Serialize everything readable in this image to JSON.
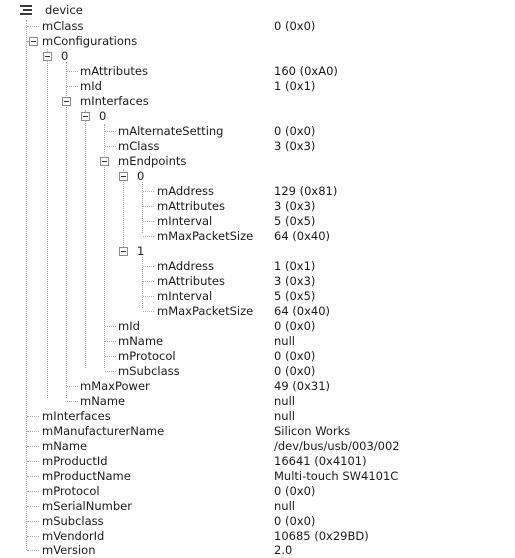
{
  "tree": {
    "root_label": "device",
    "rows": [
      {
        "label": "device",
        "value": "",
        "toggle": false,
        "root": true
      },
      {
        "label": "mClass",
        "value": "0 (0x0)"
      },
      {
        "label": "mConfigurations",
        "value": "",
        "toggle": true
      },
      {
        "label": "0",
        "value": "",
        "toggle": true
      },
      {
        "label": "mAttributes",
        "value": "160 (0xA0)"
      },
      {
        "label": "mId",
        "value": "1 (0x1)"
      },
      {
        "label": "mInterfaces",
        "value": "",
        "toggle": true
      },
      {
        "label": "0",
        "value": "",
        "toggle": true
      },
      {
        "label": "mAlternateSetting",
        "value": "0 (0x0)"
      },
      {
        "label": "mClass",
        "value": "3 (0x3)"
      },
      {
        "label": "mEndpoints",
        "value": "",
        "toggle": true
      },
      {
        "label": "0",
        "value": "",
        "toggle": true
      },
      {
        "label": "mAddress",
        "value": "129 (0x81)"
      },
      {
        "label": "mAttributes",
        "value": "3 (0x3)"
      },
      {
        "label": "mInterval",
        "value": "5 (0x5)"
      },
      {
        "label": "mMaxPacketSize",
        "value": "64 (0x40)"
      },
      {
        "label": "1",
        "value": "",
        "toggle": true
      },
      {
        "label": "mAddress",
        "value": "1 (0x1)"
      },
      {
        "label": "mAttributes",
        "value": "3 (0x3)"
      },
      {
        "label": "mInterval",
        "value": "5 (0x5)"
      },
      {
        "label": "mMaxPacketSize",
        "value": "64 (0x40)"
      },
      {
        "label": "mId",
        "value": "0 (0x0)"
      },
      {
        "label": "mName",
        "value": "null"
      },
      {
        "label": "mProtocol",
        "value": "0 (0x0)"
      },
      {
        "label": "mSubclass",
        "value": "0 (0x0)"
      },
      {
        "label": "mMaxPower",
        "value": "49 (0x31)"
      },
      {
        "label": "mName",
        "value": "null"
      },
      {
        "label": "mInterfaces",
        "value": "null"
      },
      {
        "label": "mManufacturerName",
        "value": "Silicon Works"
      },
      {
        "label": "mName",
        "value": "/dev/bus/usb/003/002"
      },
      {
        "label": "mProductId",
        "value": "16641 (0x4101)"
      },
      {
        "label": "mProductName",
        "value": "Multi-touch SW4101C"
      },
      {
        "label": "mProtocol",
        "value": "0 (0x0)"
      },
      {
        "label": "mSerialNumber",
        "value": "null"
      },
      {
        "label": "mSubclass",
        "value": "0 (0x0)"
      },
      {
        "label": "mVendorId",
        "value": "10685 (0x29BD)"
      },
      {
        "label": "mVersion",
        "value": "2.0"
      }
    ]
  }
}
